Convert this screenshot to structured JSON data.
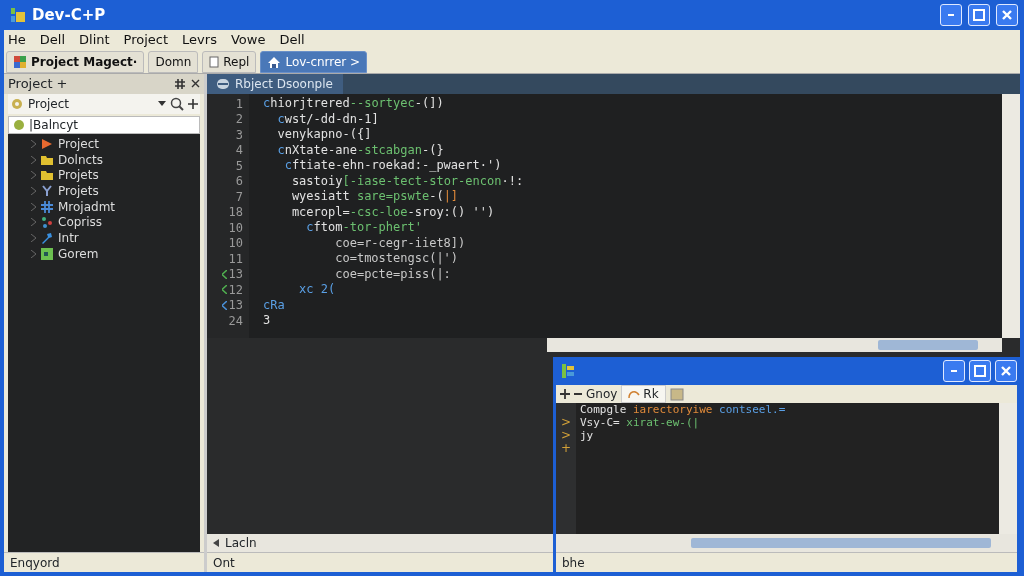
{
  "window": {
    "title": "Dev-C+P"
  },
  "menu": [
    "He",
    "Dell",
    "Dlint",
    "Project",
    "Levrs",
    "Vowe",
    "Dell"
  ],
  "toolbar_tabs": [
    {
      "label": "Project Magect·",
      "kind": "project",
      "selected": false
    },
    {
      "label": "Domn",
      "kind": "plain",
      "selected": false
    },
    {
      "label": "Repl",
      "kind": "doc",
      "selected": false
    },
    {
      "label": "Lov-cnrrer >",
      "kind": "home",
      "selected": true
    }
  ],
  "project_panel": {
    "title": "Project +",
    "dropdown": "Project",
    "root": {
      "label": "|Balncyt",
      "selected": true
    },
    "items": [
      {
        "label": "Project",
        "kind": "play"
      },
      {
        "label": "Dolncts",
        "kind": "folder"
      },
      {
        "label": "Projets",
        "kind": "folder"
      },
      {
        "label": "Projets",
        "kind": "branch"
      },
      {
        "label": "Mrojadmt",
        "kind": "hash"
      },
      {
        "label": "Copriss",
        "kind": "network"
      },
      {
        "label": "Intr",
        "kind": "tool"
      },
      {
        "label": "Gorem",
        "kind": "image"
      }
    ],
    "status": "Enqyord"
  },
  "editor": {
    "tab": "Rbject Dsoonple",
    "lines": [
      {
        "num": "1",
        "tokens": [
          {
            "t": "c",
            "kind": "tag"
          },
          {
            "t": "hiorjtrered",
            "kind": "text"
          },
          {
            "t": "--sortyec",
            "kind": "green"
          },
          {
            "t": "-(])",
            "kind": "text"
          }
        ]
      },
      {
        "num": "2",
        "tokens": [
          {
            "t": "  c",
            "kind": "tag"
          },
          {
            "t": "wst/-dd-dn-1]",
            "kind": "text"
          }
        ]
      },
      {
        "num": "3",
        "tokens": [
          {
            "t": "  venykapno-({]",
            "kind": "text"
          }
        ]
      },
      {
        "num": "4",
        "tokens": [
          {
            "t": "  c",
            "kind": "tag"
          },
          {
            "t": "nXtate-ane",
            "kind": "text"
          },
          {
            "t": "-stcabgan",
            "kind": "green"
          },
          {
            "t": "-(}",
            "kind": "text"
          }
        ]
      },
      {
        "num": "5",
        "tokens": [
          {
            "t": "   c",
            "kind": "tag"
          },
          {
            "t": "ftiate-ehn-roekad:-_pwaert·')",
            "kind": "text"
          }
        ]
      },
      {
        "num": "6",
        "tokens": [
          {
            "t": "    sastoiy",
            "kind": "text"
          },
          {
            "t": "[-iase-tect-stor-encon",
            "kind": "green"
          },
          {
            "t": "·!:",
            "kind": "text"
          }
        ]
      },
      {
        "num": "7",
        "tokens": [
          {
            "t": "    wyesiatt ",
            "kind": "text"
          },
          {
            "t": "sare=pswte",
            "kind": "green"
          },
          {
            "t": "-(",
            "kind": "text"
          },
          {
            "t": "|]",
            "kind": "orange"
          }
        ]
      },
      {
        "num": "18",
        "tokens": [
          {
            "t": "    mceropl=",
            "kind": "text"
          },
          {
            "t": "-csc-loe",
            "kind": "green"
          },
          {
            "t": "-sroy:() '')",
            "kind": "text"
          }
        ]
      },
      {
        "num": "10",
        "tokens": [
          {
            "t": "      c",
            "kind": "tag"
          },
          {
            "t": "ftom",
            "kind": "text"
          },
          {
            "t": "-tor-phert'",
            "kind": "green"
          }
        ]
      },
      {
        "num": "10",
        "tokens": [
          {
            "t": "          coe=r-cegr-iiet8])",
            "kind": "dim"
          }
        ]
      },
      {
        "num": "11",
        "tokens": [
          {
            "t": "          co=tmostengsc(|')",
            "kind": "dim"
          }
        ]
      },
      {
        "num": "13",
        "tokens": [
          {
            "t": "          coe=pcte=piss(|:",
            "kind": "dim"
          }
        ]
      },
      {
        "num": "12",
        "tokens": [
          {
            "t": "     xc 2(",
            "kind": "tag"
          }
        ]
      },
      {
        "num": "13",
        "tokens": [
          {
            "t": "cRa",
            "kind": "tag"
          }
        ]
      },
      {
        "num": "24",
        "tokens": [
          {
            "t": "3",
            "kind": "text"
          }
        ]
      }
    ],
    "bottom_label": "Lacln",
    "status": "Ont"
  },
  "output_window": {
    "toolbar": "Gnoy",
    "tab": "Rk",
    "lines": [
      {
        "tokens": [
          {
            "t": "Compgle ",
            "kind": "text"
          },
          {
            "t": "iarectoryiwe ",
            "kind": "orange"
          },
          {
            "t": "contseel.=",
            "kind": "tag"
          }
        ]
      },
      {
        "mark": ">",
        "tokens": [
          {
            "t": "Vsy-C= ",
            "kind": "text"
          },
          {
            "t": "xirat-ew-(|",
            "kind": "green"
          }
        ]
      },
      {
        "mark": ">",
        "tokens": [
          {
            "t": "jy",
            "kind": "text"
          }
        ]
      },
      {
        "mark": "+"
      }
    ],
    "status": "bhe"
  }
}
